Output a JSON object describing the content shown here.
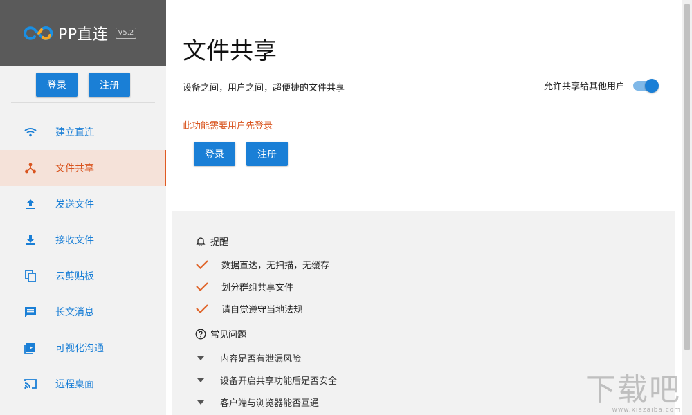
{
  "app": {
    "brand_name": "PP直连",
    "version": "V5.2"
  },
  "sidebar": {
    "login_label": "登录",
    "register_label": "注册",
    "items": [
      {
        "label": "建立直连",
        "icon": "wifi-icon",
        "active": false
      },
      {
        "label": "文件共享",
        "icon": "share-icon",
        "active": true
      },
      {
        "label": "发送文件",
        "icon": "upload-icon",
        "active": false
      },
      {
        "label": "接收文件",
        "icon": "download-icon",
        "active": false
      },
      {
        "label": "云剪贴板",
        "icon": "copy-icon",
        "active": false
      },
      {
        "label": "长文消息",
        "icon": "message-icon",
        "active": false
      },
      {
        "label": "可视化沟通",
        "icon": "video-icon",
        "active": false
      },
      {
        "label": "远程桌面",
        "icon": "cast-icon",
        "active": false
      }
    ]
  },
  "main": {
    "title": "文件共享",
    "subtitle": "设备之间，用户之间，超便捷的文件共享",
    "share_toggle_label": "允许共享给其他用户",
    "share_toggle_on": true,
    "warning": "此功能需要用户先登录",
    "login_label": "登录",
    "register_label": "注册"
  },
  "reminder": {
    "title": "提醒",
    "items": [
      "数据直达，无扫描，无缓存",
      "划分群组共享文件",
      "请自觉遵守当地法规"
    ]
  },
  "faq": {
    "title": "常见问题",
    "items": [
      "内容是否有泄漏风险",
      "设备开启共享功能后是否安全",
      "客户端与浏览器能否互通"
    ]
  },
  "watermark": {
    "main": "下载吧",
    "sub": "www.xiazaiba.com"
  },
  "colors": {
    "accent": "#1a7fd6",
    "active": "#d9541e",
    "active_bg": "#f5e2d9",
    "brand_bg": "#5a5a5a"
  }
}
